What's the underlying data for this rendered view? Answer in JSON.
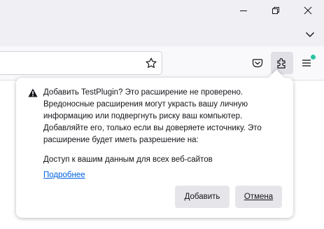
{
  "window": {
    "controls": [
      "minimize-icon",
      "restore-icon",
      "close-icon"
    ]
  },
  "toolbar": {
    "icons": [
      "star-icon",
      "pocket-icon",
      "puzzle-icon",
      "hamburger-menu-icon",
      "chevron-down-icon"
    ],
    "menu_badge_color": "#2ac3a2"
  },
  "popup": {
    "warning_icon": "warning-icon",
    "heading_lines": [
      "Добавить TestPlugin? Это расширение не проверено.",
      "Вредоносные расширения могут украсть вашу личную",
      "информацию или подвергнуть риску ваш компьютер.",
      "Добавляйте его, только если вы доверяете источнику. Это",
      "расширение будет иметь разрешение на:"
    ],
    "permission": "Доступ к вашим данным для всех веб-сайтов",
    "learn_more": "Подробнее",
    "add_button": "Добавить",
    "cancel_button": "Отмена"
  },
  "colors": {
    "link": "#0061e0",
    "button_bg": "#e6e6ea",
    "toolbar_bg": "#f9f9fb",
    "titlebar_bg": "#f0f0f4"
  }
}
